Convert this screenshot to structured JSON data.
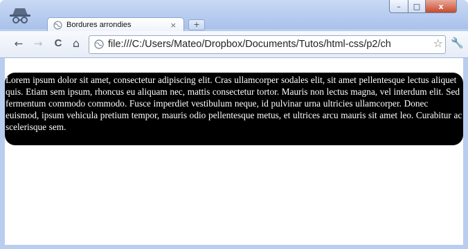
{
  "window": {
    "tab_title": "Bordures arrondies",
    "tab_close": "×",
    "new_tab": "+"
  },
  "controls": {
    "minimize": "–",
    "maximize": "□",
    "close": "x"
  },
  "toolbar": {
    "back": "←",
    "forward": "→",
    "reload": "C",
    "home": "⌂",
    "url": "file:///C:/Users/Mateo/Dropbox/Documents/Tutos/html-css/p2/ch",
    "bookmark": "☆",
    "wrench": "🔧"
  },
  "page": {
    "paragraph": "Lorem ipsum dolor sit amet, consectetur adipiscing elit. Cras ullamcorper sodales elit, sit amet pellentesque lectus aliquet quis. Etiam sem ipsum, rhoncus eu aliquam nec, mattis consectetur tortor. Mauris non lectus magna, vel interdum elit. Sed fermentum commodo commodo. Fusce imperdiet vestibulum neque, id pulvinar urna ultricies ullamcorper. Donec euismod, ipsum vehicula pretium tempor, mauris odio pellentesque metus, et ultrices arcu mauris sit amet leo. Curabitur ac scelerisque sem."
  }
}
